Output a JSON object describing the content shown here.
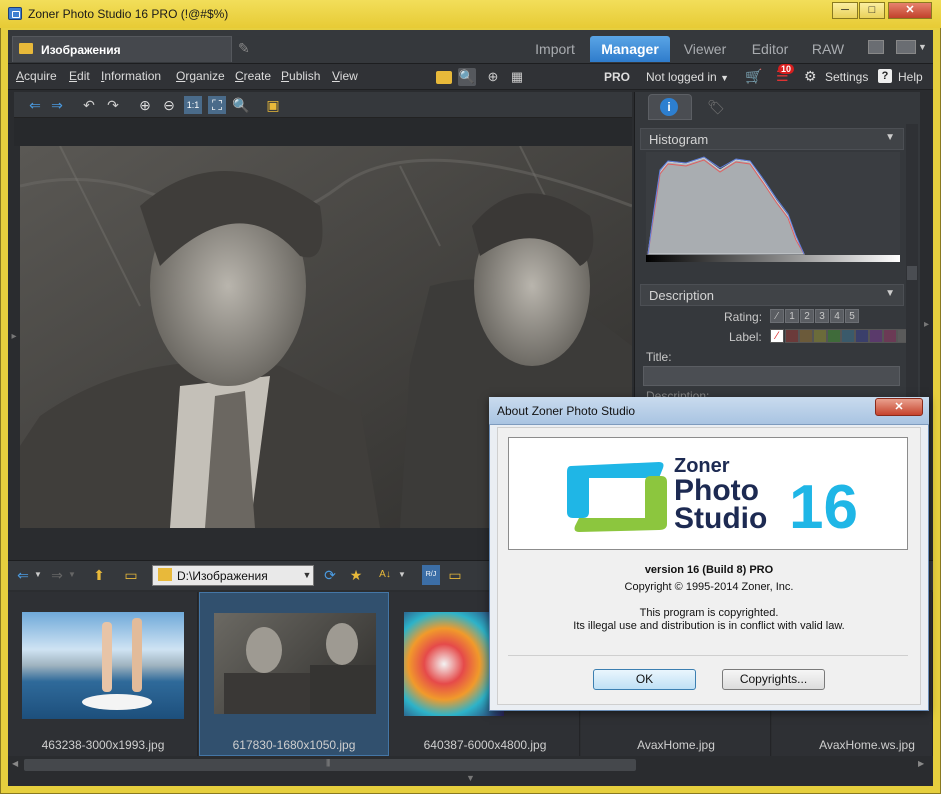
{
  "window": {
    "title": "Zoner Photo Studio 16 PRO  (!@#$%)",
    "controls": {
      "minimize": "─",
      "maximize": "□",
      "close": "✕"
    }
  },
  "doc_tab": {
    "label": "Изображения"
  },
  "modules": [
    {
      "label": "Import",
      "active": false
    },
    {
      "label": "Manager",
      "active": true
    },
    {
      "label": "Viewer",
      "active": false
    },
    {
      "label": "Editor",
      "active": false
    },
    {
      "label": "RAW",
      "active": false
    }
  ],
  "menu": {
    "items": [
      {
        "label": "Acquire",
        "accel": "A",
        "rest": "cquire"
      },
      {
        "label": "Edit",
        "accel": "E",
        "rest": "dit"
      },
      {
        "label": "Information",
        "accel": "I",
        "rest": "nformation"
      },
      {
        "label": "Organize",
        "accel": "O",
        "rest": "rganize"
      },
      {
        "label": "Create",
        "accel": "C",
        "rest": "reate"
      },
      {
        "label": "Publish",
        "accel": "P",
        "rest": "ublish"
      },
      {
        "label": "View",
        "accel": "V",
        "rest": "iew"
      }
    ],
    "pro": "PRO",
    "account": "Not logged in",
    "notifications": "10",
    "settings": "Settings",
    "help": "Help"
  },
  "right_panel": {
    "histogram_title": "Histogram",
    "description_title": "Description",
    "rating_label": "Rating:",
    "ratings": [
      "1",
      "2",
      "3",
      "4",
      "5"
    ],
    "label_label": "Label:",
    "label_colors": [
      "#6b3a3a",
      "#6b5a3a",
      "#6b6b3a",
      "#3f6b3a",
      "#3a5a6b",
      "#3a3f6b",
      "#5a3a6b",
      "#6b3a55",
      "#5a5a5a"
    ],
    "title_label": "Title:",
    "description_label": "Description:"
  },
  "browser": {
    "path": "D:\\Изображения"
  },
  "thumbnails": [
    {
      "name": "463238-3000x1993.jpg",
      "selected": false
    },
    {
      "name": "617830-1680x1050.jpg",
      "selected": true
    },
    {
      "name": "640387-6000x4800.jpg",
      "selected": false
    },
    {
      "name": "AvaxHome.jpg",
      "selected": false
    },
    {
      "name": "AvaxHome.ws.jpg",
      "selected": false
    }
  ],
  "about_dialog": {
    "title": "About Zoner Photo Studio",
    "close": "✕",
    "logo_word1": "Zoner",
    "logo_word2": "Photo",
    "logo_word3": "Studio",
    "logo_version": "16",
    "version": "version 16 (Build 8) PRO",
    "copyright": "Copyright © 1995-2014 Zoner, Inc.",
    "notice1": "This program is copyrighted.",
    "notice2": "Its illegal use and distribution is in conflict with valid law.",
    "ok": "OK",
    "copyrights": "Copyrights..."
  },
  "colors": {
    "accent": "#2f7ccc",
    "title_bar": "#e7cb35",
    "logo_cyan": "#1fb6e6",
    "logo_green": "#8cc63e",
    "logo_navy": "#1d2a52"
  }
}
